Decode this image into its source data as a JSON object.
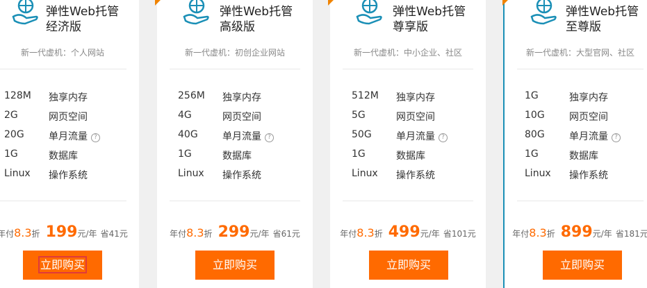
{
  "plans": [
    {
      "title_line1": "弹性Web托管",
      "title_line2": "经济版",
      "subtitle": "新一代虚机：个人网站",
      "specs": [
        {
          "value": "128M",
          "label": "独享内存"
        },
        {
          "value": "2G",
          "label": "网页空间"
        },
        {
          "value": "20G",
          "label": "单月流量"
        },
        {
          "value": "1G",
          "label": "数据库"
        },
        {
          "value": "Linux",
          "label": "操作系统"
        }
      ],
      "price_prefix": "年付",
      "discount": "8.3",
      "discount_unit": "折",
      "price": "199",
      "price_unit": "元/年",
      "save": "省41元",
      "buy_label": "立即购买"
    },
    {
      "title_line1": "弹性Web托管",
      "title_line2": "高级版",
      "subtitle": "新一代虚机：初创企业网站",
      "specs": [
        {
          "value": "256M",
          "label": "独享内存"
        },
        {
          "value": "4G",
          "label": "网页空间"
        },
        {
          "value": "40G",
          "label": "单月流量"
        },
        {
          "value": "1G",
          "label": "数据库"
        },
        {
          "value": "Linux",
          "label": "操作系统"
        }
      ],
      "price_prefix": "年付",
      "discount": "8.3",
      "discount_unit": "折",
      "price": "299",
      "price_unit": "元/年",
      "save": "省61元",
      "buy_label": "立即购买"
    },
    {
      "title_line1": "弹性Web托管",
      "title_line2": "尊享版",
      "subtitle": "新一代虚机：中小企业、社区",
      "specs": [
        {
          "value": "512M",
          "label": "独享内存"
        },
        {
          "value": "5G",
          "label": "网页空间"
        },
        {
          "value": "50G",
          "label": "单月流量"
        },
        {
          "value": "1G",
          "label": "数据库"
        },
        {
          "value": "Linux",
          "label": "操作系统"
        }
      ],
      "price_prefix": "年付",
      "discount": "8.3",
      "discount_unit": "折",
      "price": "499",
      "price_unit": "元/年",
      "save": "省101元",
      "buy_label": "立即购买"
    },
    {
      "title_line1": "弹性Web托管",
      "title_line2": "至尊版",
      "subtitle": "新一代虚机：大型官网、社区",
      "specs": [
        {
          "value": "1G",
          "label": "独享内存"
        },
        {
          "value": "10G",
          "label": "网页空间"
        },
        {
          "value": "80G",
          "label": "单月流量"
        },
        {
          "value": "1G",
          "label": "数据库"
        },
        {
          "value": "Linux",
          "label": "操作系统"
        }
      ],
      "price_prefix": "年付",
      "discount": "8.3",
      "discount_unit": "折",
      "price": "899",
      "price_unit": "元/年",
      "save": "省181元",
      "buy_label": "立即购买"
    }
  ],
  "help_glyph": "?",
  "colors": {
    "accent": "#ff6a00",
    "logo": "#1a8fb6",
    "corner": "#f08300",
    "focus_outline": "#e03a3a"
  },
  "icons": {
    "logo": "globe-in-hand-icon",
    "help": "question-circle-icon"
  }
}
